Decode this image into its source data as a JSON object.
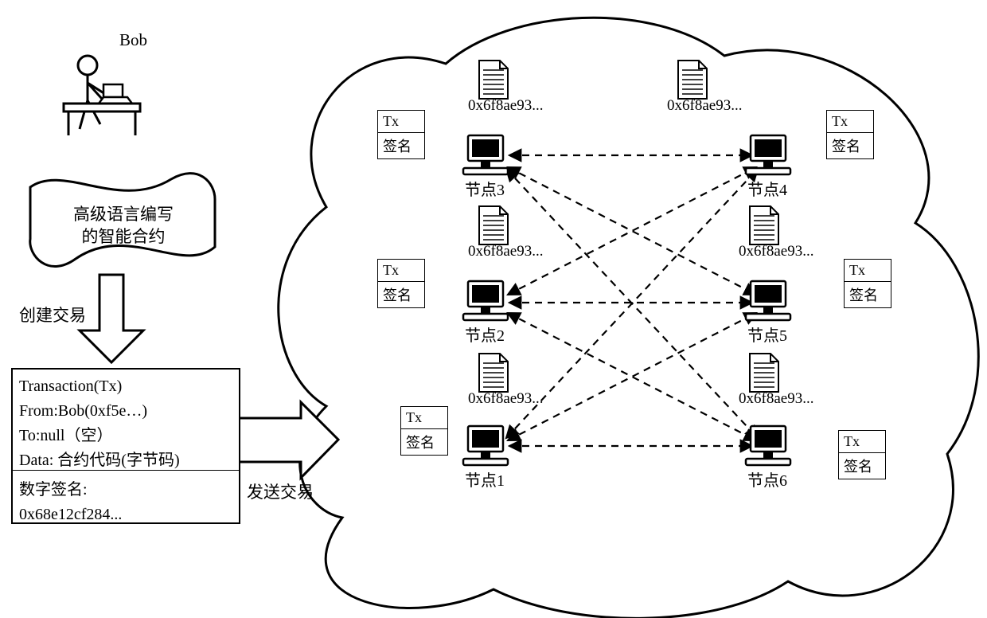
{
  "user": {
    "name": "Bob"
  },
  "scroll": {
    "line1": "高级语言编写",
    "line2": "的智能合约"
  },
  "flow": {
    "create_tx": "创建交易",
    "send_tx": "发送交易"
  },
  "transaction": {
    "header": "Transaction(Tx)",
    "from": "From:Bob(0xf5e…)",
    "to": "To:null（空）",
    "data": "Data: 合约代码(字节码)",
    "sig_label": "数字签名:",
    "sig_value": "0x68e12cf284..."
  },
  "cell": {
    "tx": "Tx",
    "sig": "签名"
  },
  "address": "0x6f8ae93...",
  "nodes": {
    "n1": "节点1",
    "n2": "节点2",
    "n3": "节点3",
    "n4": "节点4",
    "n5": "节点5",
    "n6": "节点6"
  }
}
